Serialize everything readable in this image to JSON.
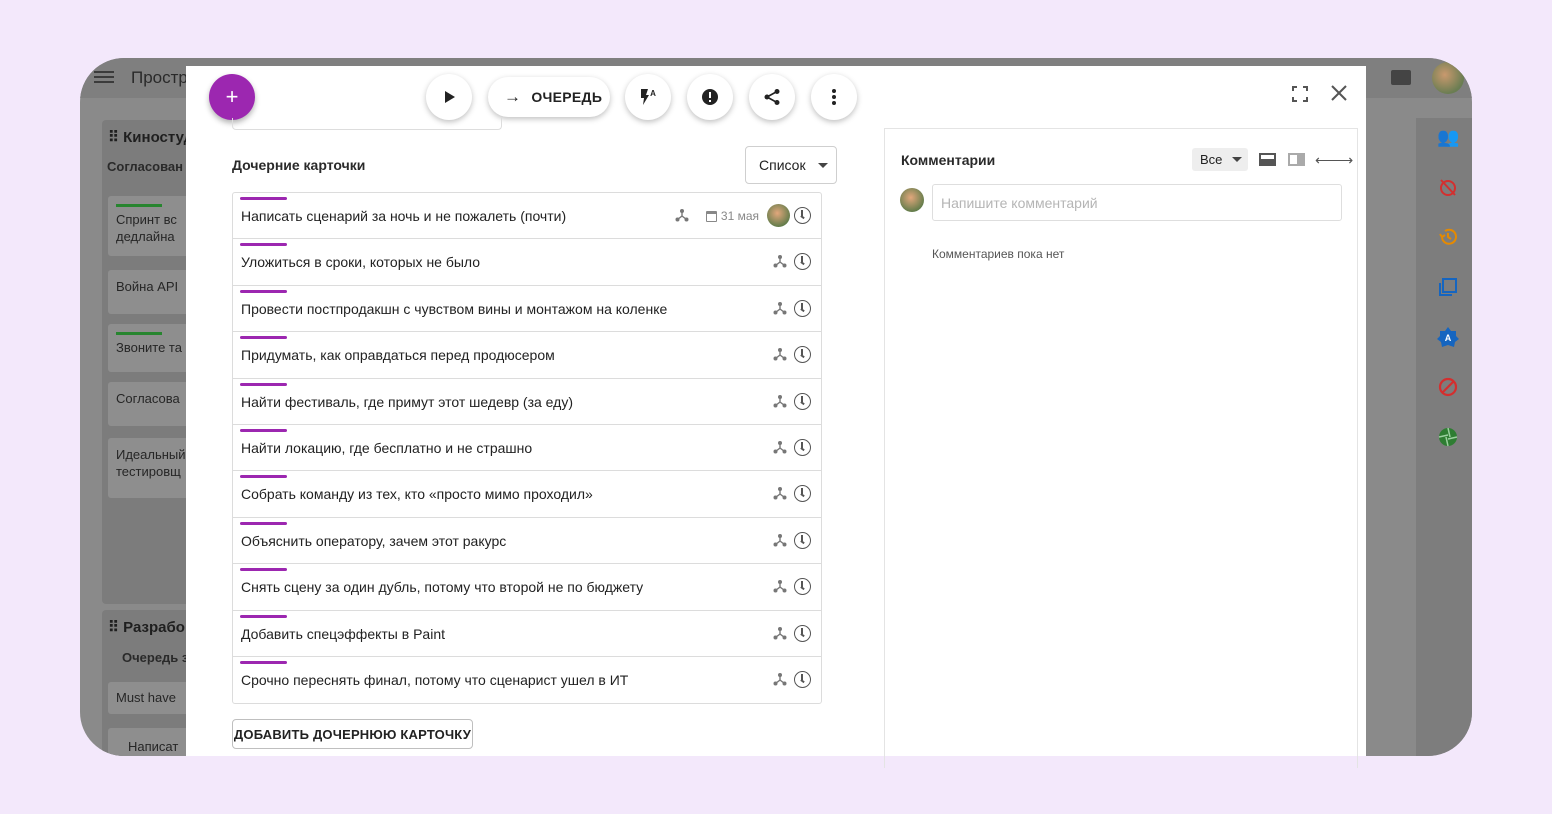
{
  "background_app": {
    "title": "Простр",
    "column1": {
      "title": "Киностуди",
      "subtitle": "Согласован",
      "cards": [
        "Спринт вс\nдедлайна",
        "Война API",
        "Звоните та",
        "Согласова",
        "Идеальный\nтестировщ"
      ]
    },
    "column2": {
      "title": "Разрабо",
      "subtitle": "Очередь з",
      "cards": [
        "Must have",
        "Написат"
      ]
    }
  },
  "toolbar": {
    "add_label": "+",
    "queue_label": "ОЧЕРЕДЬ"
  },
  "child_cards": {
    "title": "Дочерние карточки",
    "view_select": "Список",
    "items": [
      {
        "text": "Написать сценарий за ночь и не пожалеть (почти)",
        "date": "31 мая"
      },
      {
        "text": "Уложиться в сроки, которых не было"
      },
      {
        "text": "Провести постпродакшн с чувством вины и монтажом на коленке"
      },
      {
        "text": "Придумать, как оправдаться перед продюсером"
      },
      {
        "text": "Найти фестиваль, где примут этот шедевр (за еду)"
      },
      {
        "text": "Найти локацию, где бесплатно и не страшно"
      },
      {
        "text": "Собрать команду из тех, кто «просто мимо проходил»"
      },
      {
        "text": "Объяснить оператору, зачем этот ракурс"
      },
      {
        "text": "Снять сцену за один дубль, потому что второй не по бюджету"
      },
      {
        "text": "Добавить спецэффекты в Paint"
      },
      {
        "text": "Срочно переснять финал, потому что сценарист ушел в ИТ"
      }
    ],
    "add_button": "ДОБАВИТЬ ДОЧЕРНЮЮ КАРТОЧКУ"
  },
  "comments": {
    "title": "Комментарии",
    "filter": "Все",
    "input_placeholder": "Напишите комментарий",
    "empty_text": "Комментариев пока нет"
  },
  "colors": {
    "accent": "#9c27b0",
    "rail_people": "#7b1fa2",
    "rail_red": "#d32f2f",
    "rail_orange": "#e68a00",
    "rail_blue": "#1565c0",
    "rail_green": "#2e7d32"
  },
  "icons": {
    "toolbar": [
      "play-icon",
      "arrow-right-icon",
      "flash-auto-icon",
      "alert-icon",
      "share-icon",
      "more-vert-icon"
    ],
    "rail": [
      "people-icon",
      "timer-off-icon",
      "history-icon",
      "copy-icon",
      "badge-icon",
      "block-icon",
      "aperture-icon"
    ]
  }
}
